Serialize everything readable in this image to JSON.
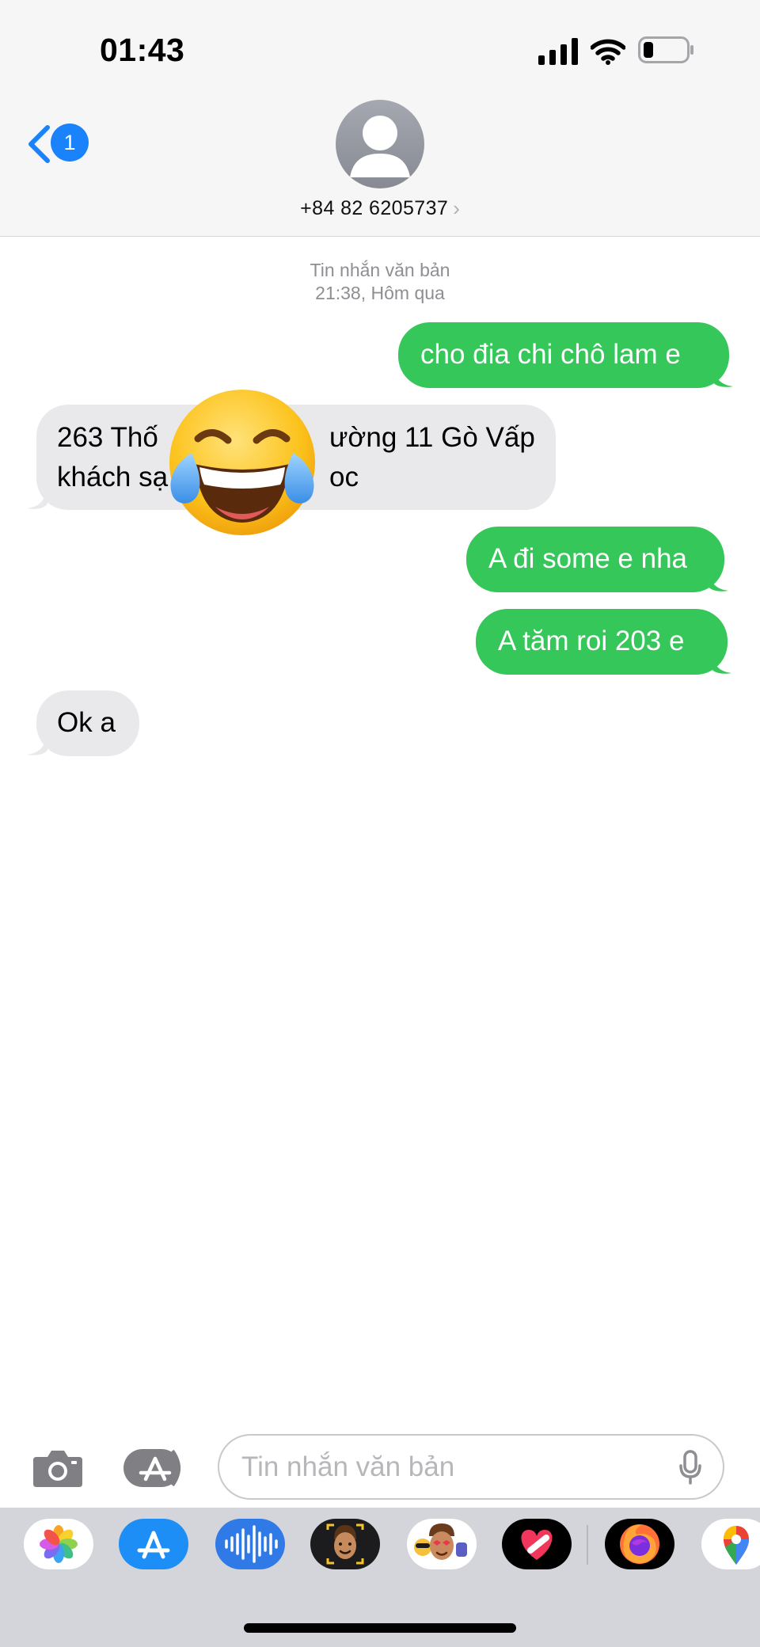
{
  "status_bar": {
    "time": "01:43"
  },
  "nav": {
    "unread_badge": "1",
    "contact_number": "+84 82 6205737",
    "chevron": "›"
  },
  "thread": {
    "label": "Tin nhắn văn bản",
    "timestamp": "21:38, Hôm qua"
  },
  "messages": [
    {
      "direction": "sent",
      "lines": [
        "cho đia chi chô lam e"
      ]
    },
    {
      "direction": "received",
      "lines": [
        "263 Thống ... ường 11 Gò Vấp",
        "khách sạ ... oc"
      ]
    },
    {
      "direction": "sent",
      "lines": [
        "A đi some e nha"
      ]
    },
    {
      "direction": "sent",
      "lines": [
        "A tăm roi 203 e"
      ]
    },
    {
      "direction": "received",
      "lines": [
        "Ok a"
      ]
    }
  ],
  "visible_fragments": {
    "msg2_line1_left": "263 Thố",
    "msg2_line1_right": "ường 11 Gò Vấp",
    "msg2_line2_left": "khách sạ",
    "msg2_line2_right": "oc"
  },
  "sticker": {
    "icon": "face-with-tears-of-joy-icon"
  },
  "compose": {
    "placeholder": "Tin nhắn văn bản"
  },
  "app_drawer": {
    "apps": [
      "photos-icon",
      "app-store-icon",
      "audio-message-icon",
      "memoji-icon",
      "animoji-stickers-icon",
      "digital-touch-icon",
      "firefox-icon",
      "google-maps-icon"
    ]
  },
  "colors": {
    "sent_bubble": "#35c759",
    "received_bubble": "#e9e9eb",
    "accent": "#1a82fb",
    "header_bg": "#f6f6f6",
    "drawer_bg": "#d3d5da"
  }
}
